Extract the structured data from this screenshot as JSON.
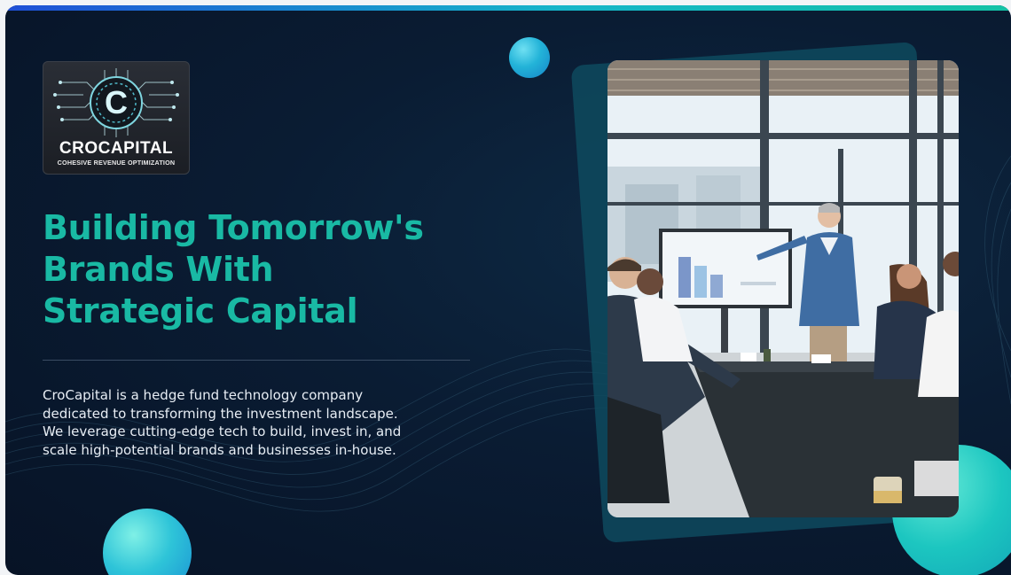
{
  "brand": {
    "name": "CROCAPITAL",
    "tagline": "COHESIVE REVENUE OPTIMIZATION",
    "emblem_letter": "C"
  },
  "hero": {
    "headline_lines": [
      "Building Tomorrow's",
      "Brands With",
      "Strategic Capital"
    ],
    "description_lines": [
      "CroCapital is a hedge fund technology company",
      "dedicated to transforming the investment landscape.",
      "We leverage cutting-edge tech to build, invest in, and",
      "scale high-potential brands and businesses in-house."
    ]
  },
  "photo": {
    "subject": "business-meeting-presentation"
  },
  "colors": {
    "background": "#0a1c33",
    "accent": "#19b9a4",
    "top_bar_start": "#1f4fd6",
    "top_bar_end": "#13c2a6"
  }
}
